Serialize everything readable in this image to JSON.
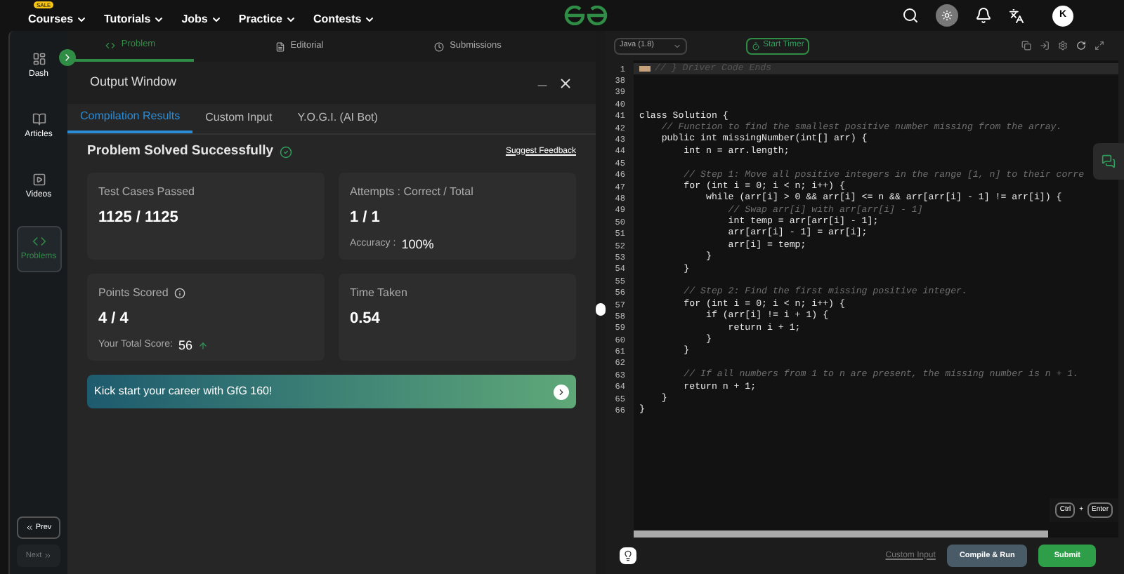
{
  "nav": {
    "sale_badge": "SALE",
    "items": [
      "Courses",
      "Tutorials",
      "Jobs",
      "Practice",
      "Contests"
    ],
    "avatar": "K"
  },
  "sidebar": {
    "items": [
      {
        "label": "Dash",
        "selected": false
      },
      {
        "label": "Articles",
        "selected": false
      },
      {
        "label": "Videos",
        "selected": false
      },
      {
        "label": "Problems",
        "selected": true
      }
    ],
    "prev": "Prev",
    "next": "Next"
  },
  "problem_tabs": [
    {
      "label": "Problem",
      "selected": true
    },
    {
      "label": "Editorial",
      "selected": false
    },
    {
      "label": "Submissions",
      "selected": false
    }
  ],
  "output_window": {
    "title": "Output Window",
    "tabs": [
      {
        "label": "Compilation Results",
        "selected": true
      },
      {
        "label": "Custom Input",
        "selected": false
      },
      {
        "label": "Y.O.G.I. (AI Bot)",
        "selected": false
      }
    ],
    "status": "Problem Solved Successfully",
    "feedback_link": "Suggest Feedback",
    "cards": [
      {
        "label": "Test Cases Passed",
        "info": false,
        "value": "1125 / 1125"
      },
      {
        "label": "Attempts : Correct / Total",
        "info": false,
        "value": "1 / 1",
        "note_label": "Accuracy :",
        "note_value": "100%",
        "rising": false
      },
      {
        "label": "Points Scored",
        "info": true,
        "value": "4 / 4",
        "note_label": "Your Total Score:",
        "note_value": "56",
        "rising": true
      },
      {
        "label": "Time Taken",
        "info": false,
        "value": "0.54"
      }
    ],
    "banner": "Kick start your career with GfG 160!"
  },
  "editor": {
    "language": "Java (1.8)",
    "timer_button": "Start Timer",
    "lines": [
      {
        "number": "1",
        "text": "// } Driver Code Ends",
        "kind": "folded"
      },
      {
        "number": "38",
        "kind": "code"
      },
      {
        "number": "39",
        "kind": "code"
      },
      {
        "number": "40",
        "kind": "code"
      },
      {
        "number": "41",
        "text": "class Solution {",
        "kind": "code"
      },
      {
        "number": "42",
        "text": "    // Function to find the smallest positive number missing from the array.",
        "kind": "comment"
      },
      {
        "number": "43",
        "text": "    public int missingNumber(int[] arr) {",
        "kind": "code"
      },
      {
        "number": "44",
        "text": "        int n = arr.length;",
        "kind": "code"
      },
      {
        "number": "45",
        "kind": "code"
      },
      {
        "number": "46",
        "text": "        // Step 1: Move all positive integers in the range [1, n] to their corre",
        "kind": "comment"
      },
      {
        "number": "47",
        "text": "        for (int i = 0; i < n; i++) {",
        "kind": "code"
      },
      {
        "number": "48",
        "text": "            while (arr[i] > 0 && arr[i] <= n && arr[arr[i] - 1] != arr[i]) {",
        "kind": "code"
      },
      {
        "number": "49",
        "text": "                // Swap arr[i] with arr[arr[i] - 1]",
        "kind": "comment"
      },
      {
        "number": "50",
        "text": "                int temp = arr[arr[i] - 1];",
        "kind": "code"
      },
      {
        "number": "51",
        "text": "                arr[arr[i] - 1] = arr[i];",
        "kind": "code"
      },
      {
        "number": "52",
        "text": "                arr[i] = temp;",
        "kind": "code"
      },
      {
        "number": "53",
        "text": "            }",
        "kind": "code"
      },
      {
        "number": "54",
        "text": "        }",
        "kind": "code"
      },
      {
        "number": "55",
        "kind": "code"
      },
      {
        "number": "56",
        "text": "        // Step 2: Find the first missing positive integer.",
        "kind": "comment"
      },
      {
        "number": "57",
        "text": "        for (int i = 0; i < n; i++) {",
        "kind": "code"
      },
      {
        "number": "58",
        "text": "            if (arr[i] != i + 1) {",
        "kind": "code"
      },
      {
        "number": "59",
        "text": "                return i + 1;",
        "kind": "code"
      },
      {
        "number": "60",
        "text": "            }",
        "kind": "code"
      },
      {
        "number": "61",
        "text": "        }",
        "kind": "code"
      },
      {
        "number": "62",
        "kind": "code"
      },
      {
        "number": "63",
        "text": "        // If all numbers from 1 to n are present, the missing number is n + 1.",
        "kind": "comment"
      },
      {
        "number": "64",
        "text": "        return n + 1;",
        "kind": "code"
      },
      {
        "number": "65",
        "text": "    }",
        "kind": "code"
      },
      {
        "number": "66",
        "text": "}",
        "kind": "code"
      }
    ],
    "shortcut": {
      "keys": [
        "Ctrl",
        "Enter"
      ],
      "joiner": "+"
    },
    "custom_input": "Custom Input",
    "compile_button": "Compile & Run",
    "submit_button": "Submit"
  }
}
